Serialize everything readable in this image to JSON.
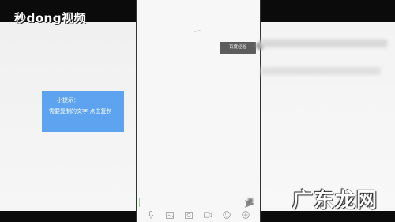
{
  "watermark": {
    "top_logo": "秒dong视频",
    "bottom_logo": "广东龙网"
  },
  "tip_box": {
    "title": "小提示：",
    "text": "需要复制的文字-点击复制"
  },
  "chat": {
    "timestamp": "一 二",
    "bubble_text": "百度经验"
  },
  "icons": {
    "send": "send-icon",
    "toolbar": [
      "microphone-icon",
      "image-icon",
      "gallery-icon",
      "video-icon",
      "emoji-icon",
      "add-icon"
    ]
  },
  "colors": {
    "tip_blue": "#5ea3f0",
    "bubble_gray": "#5d5d5d"
  }
}
